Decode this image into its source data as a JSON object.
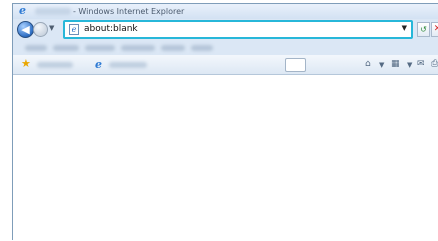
{
  "window": {
    "title": "- Windows Internet Explorer"
  },
  "navigation": {
    "back_icon": "back-arrow-icon",
    "forward_icon": "forward-arrow-icon",
    "address_value": "about:blank",
    "refresh_icon": "refresh-icon",
    "stop_icon": "stop-x-icon"
  },
  "favorites": {
    "star_icon": "star-icon"
  },
  "colors": {
    "address_focus_border": "#27b7d9",
    "stop": "#d42424",
    "refresh": "#2f8a3a"
  }
}
